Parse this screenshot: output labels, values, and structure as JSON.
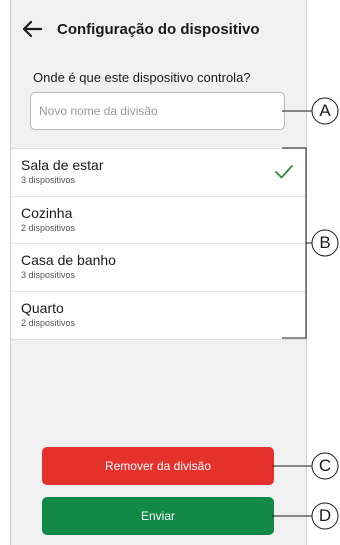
{
  "header": {
    "title": "Configuração do dispositivo",
    "back_icon": "arrow-left-icon"
  },
  "question": "Onde é que este dispositivo controla?",
  "room_name_input": {
    "placeholder": "Novo nome da divisão",
    "value": ""
  },
  "rooms": [
    {
      "name": "Sala de estar",
      "count": "3 dispositivos",
      "selected": true
    },
    {
      "name": "Cozinha",
      "count": "2 dispositivos",
      "selected": false
    },
    {
      "name": "Casa de banho",
      "count": "3 dispositivos",
      "selected": false
    },
    {
      "name": "Quarto",
      "count": "2 dispositivos",
      "selected": false
    }
  ],
  "buttons": {
    "remove_label": "Remover da divisão",
    "send_label": "Enviar"
  },
  "callouts": [
    "A",
    "B",
    "C",
    "D"
  ],
  "colors": {
    "remove": "#e5312b",
    "send": "#128a47",
    "check": "#2e8b3d",
    "background": "#f1f1f1"
  }
}
